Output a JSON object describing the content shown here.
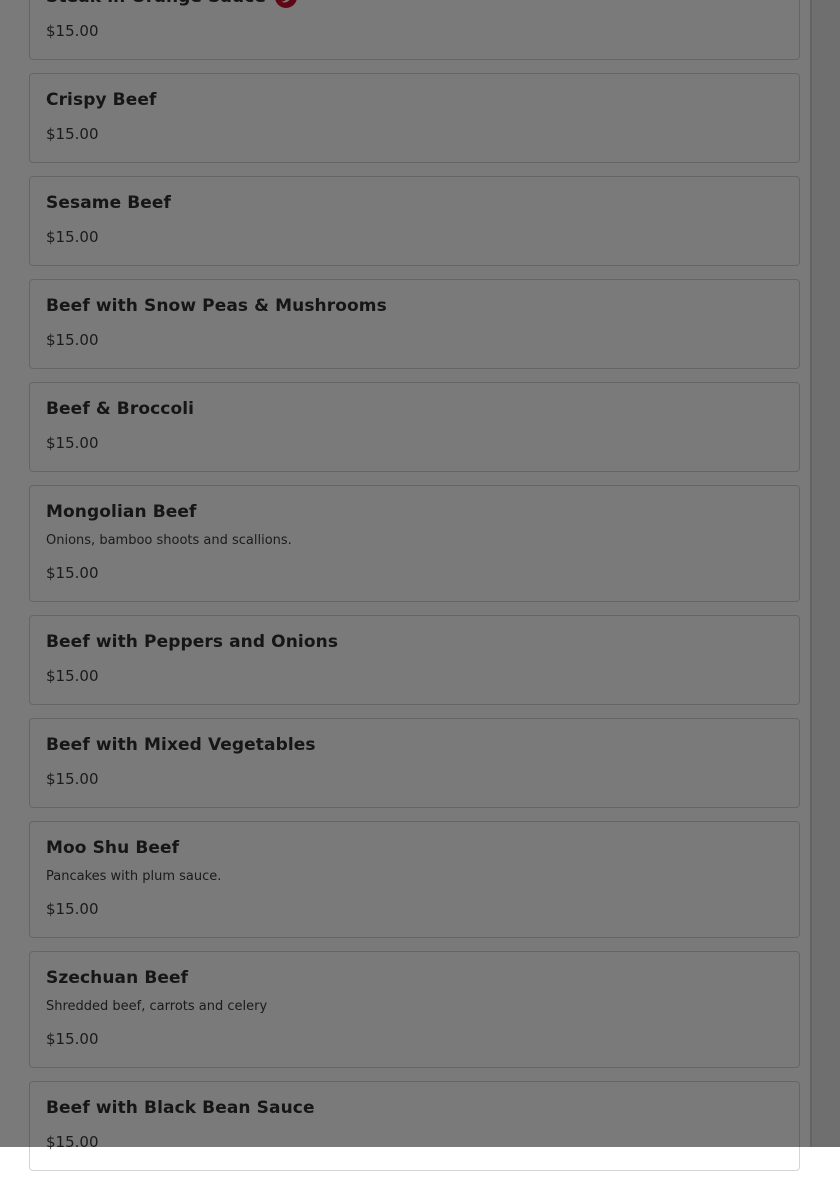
{
  "menu": {
    "items": [
      {
        "name": "Steak in Orange Sauce",
        "description": "",
        "price": "$15.00",
        "spicy": true
      },
      {
        "name": "Crispy Beef",
        "description": "",
        "price": "$15.00",
        "spicy": false
      },
      {
        "name": "Sesame Beef",
        "description": "",
        "price": "$15.00",
        "spicy": false
      },
      {
        "name": "Beef with Snow Peas & Mushrooms",
        "description": "",
        "price": "$15.00",
        "spicy": false
      },
      {
        "name": "Beef & Broccoli",
        "description": "",
        "price": "$15.00",
        "spicy": false
      },
      {
        "name": "Mongolian Beef",
        "description": "Onions, bamboo shoots and scallions.",
        "price": "$15.00",
        "spicy": false
      },
      {
        "name": "Beef with Peppers and Onions",
        "description": "",
        "price": "$15.00",
        "spicy": false
      },
      {
        "name": "Beef with Mixed Vegetables",
        "description": "",
        "price": "$15.00",
        "spicy": false
      },
      {
        "name": "Moo Shu Beef",
        "description": "Pancakes with plum sauce.",
        "price": "$15.00",
        "spicy": false
      },
      {
        "name": "Szechuan Beef",
        "description": "Shredded beef, carrots and celery",
        "price": "$15.00",
        "spicy": false
      },
      {
        "name": "Beef with Black Bean Sauce",
        "description": "",
        "price": "$15.00",
        "spicy": false
      }
    ]
  },
  "icons": {
    "spicy": "chili-pepper-icon"
  },
  "colors": {
    "spicy_icon": "#c8102e",
    "overlay": "#000000"
  }
}
